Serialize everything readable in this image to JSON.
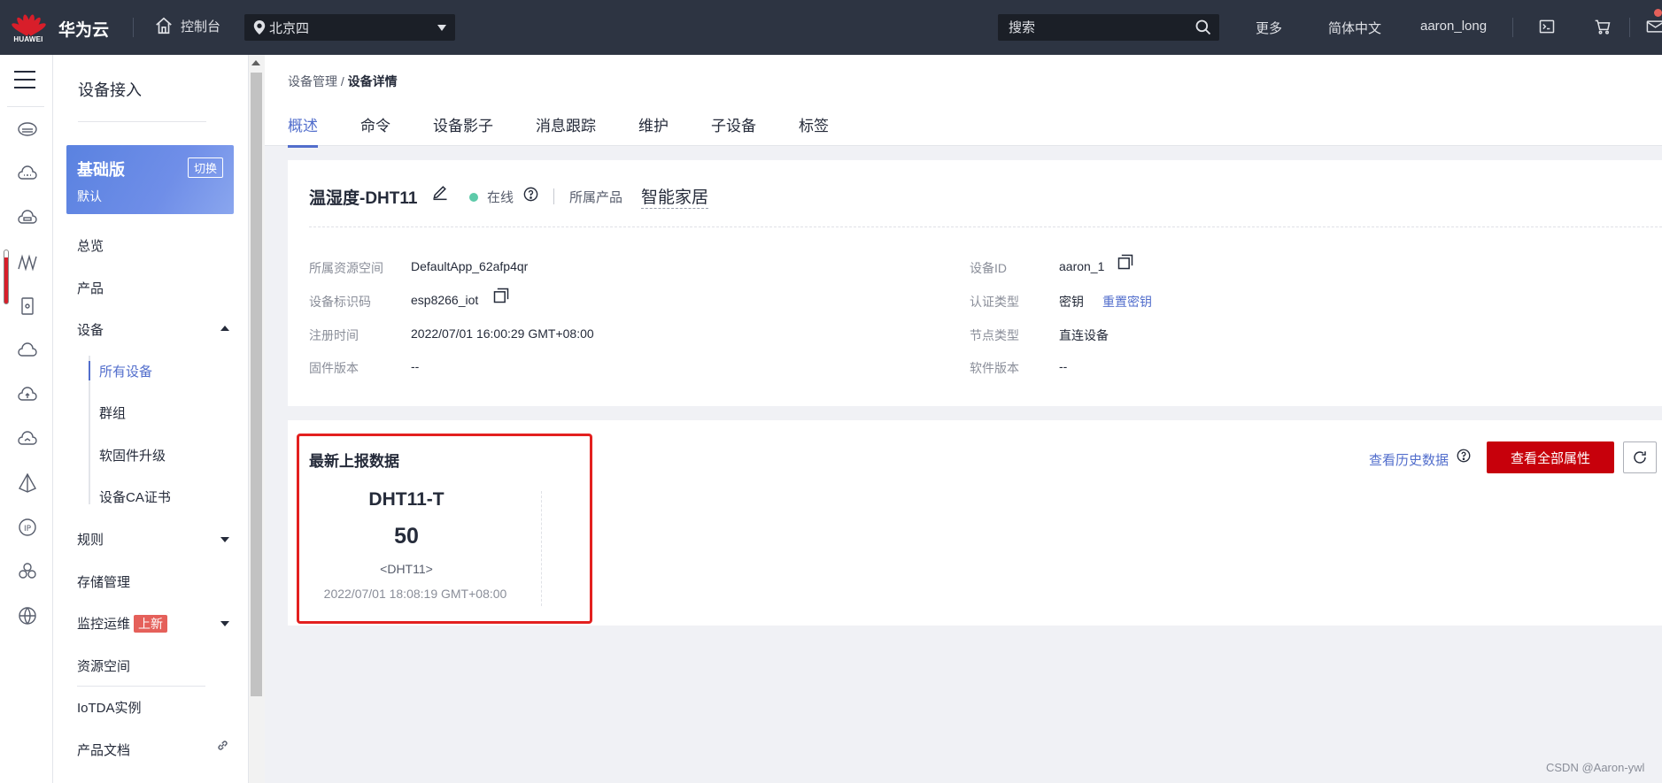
{
  "topbar": {
    "logo_text": "HUAWEI",
    "brand": "华为云",
    "console": "控制台",
    "region": "北京四",
    "search_placeholder": "搜索",
    "more": "更多",
    "language": "简体中文",
    "user": "aaron_long"
  },
  "sidenav": {
    "title": "设备接入",
    "edition": {
      "name": "基础版",
      "sub": "默认",
      "switch": "切换"
    },
    "items": {
      "overview": "总览",
      "product": "产品",
      "device": "设备",
      "all_devices": "所有设备",
      "group": "群组",
      "firmware": "软固件升级",
      "ca": "设备CA证书",
      "rules": "规则",
      "storage": "存储管理",
      "monitor": "监控运维",
      "monitor_badge": "上新",
      "resource": "资源空间",
      "iotda": "IoTDA实例",
      "docs": "产品文档"
    }
  },
  "breadcrumb": {
    "parent": "设备管理",
    "separator": "/",
    "current": "设备详情"
  },
  "tabs": [
    "概述",
    "命令",
    "设备影子",
    "消息跟踪",
    "维护",
    "子设备",
    "标签"
  ],
  "device": {
    "name": "温湿度-DHT11",
    "status": "在线",
    "product_label": "所属产品",
    "product": "智能家居",
    "fields_left": [
      {
        "label": "所属资源空间",
        "value": "DefaultApp_62afp4qr"
      },
      {
        "label": "设备标识码",
        "value": "esp8266_iot"
      },
      {
        "label": "注册时间",
        "value": "2022/07/01 16:00:29 GMT+08:00"
      },
      {
        "label": "固件版本",
        "value": "--"
      }
    ],
    "fields_right": [
      {
        "label": "设备ID",
        "value": "aaron_1"
      },
      {
        "label": "认证类型",
        "value": "密钥",
        "link": "重置密钥"
      },
      {
        "label": "节点类型",
        "value": "直连设备"
      },
      {
        "label": "软件版本",
        "value": "--"
      }
    ]
  },
  "latest": {
    "title": "最新上报数据",
    "metric": {
      "name": "DHT11-T",
      "value": "50",
      "unit": "<DHT11>",
      "time": "2022/07/01 18:08:19 GMT+08:00"
    },
    "history_link": "查看历史数据",
    "view_all_button": "查看全部属性"
  },
  "watermark": "CSDN @Aaron-ywl",
  "colors": {
    "accent": "#526ecc",
    "primary_button": "#c7000b",
    "online": "#5dcaa9",
    "topbar": "#2d3442",
    "highlight_box": "#e3201f"
  }
}
